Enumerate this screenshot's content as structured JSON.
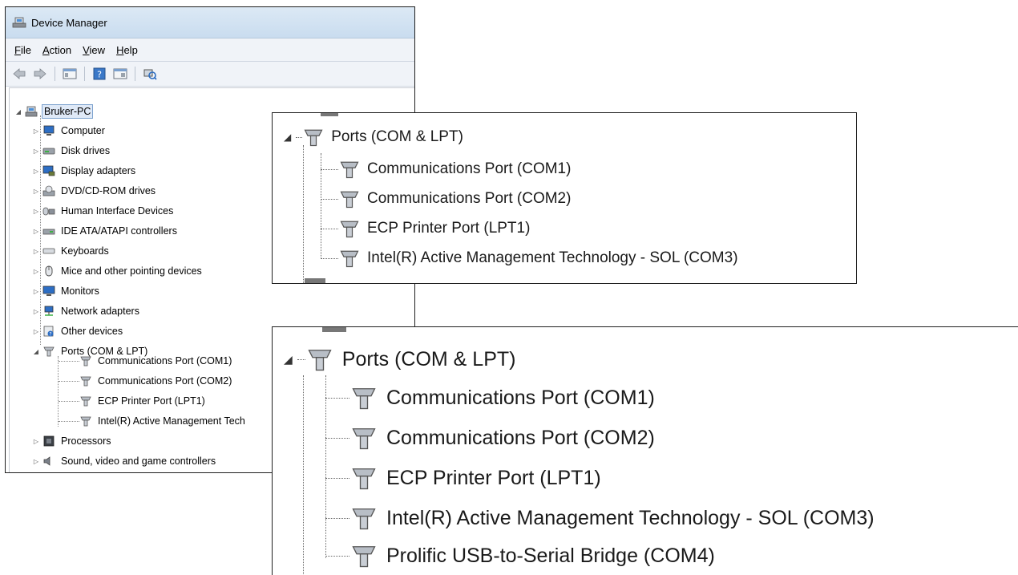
{
  "window": {
    "title": "Device Manager",
    "menu": [
      {
        "label": "File",
        "accel": "F",
        "rest": "ile"
      },
      {
        "label": "Action",
        "accel": "A",
        "rest": "ction"
      },
      {
        "label": "View",
        "accel": "V",
        "rest": "iew"
      },
      {
        "label": "Help",
        "accel": "H",
        "rest": "elp"
      }
    ],
    "toolbar": [
      "back-icon",
      "forward-icon",
      "properties-icon",
      "help-icon",
      "update-driver-icon",
      "scan-hardware-icon"
    ]
  },
  "tree": {
    "root": "Bruker-PC",
    "categories": [
      {
        "label": "Computer",
        "icon": "computer-icon"
      },
      {
        "label": "Disk drives",
        "icon": "disk-drive-icon"
      },
      {
        "label": "Display adapters",
        "icon": "display-adapter-icon"
      },
      {
        "label": "DVD/CD-ROM drives",
        "icon": "dvd-drive-icon"
      },
      {
        "label": "Human Interface Devices",
        "icon": "hid-icon"
      },
      {
        "label": "IDE ATA/ATAPI controllers",
        "icon": "ide-controller-icon"
      },
      {
        "label": "Keyboards",
        "icon": "keyboard-icon"
      },
      {
        "label": "Mice and other pointing devices",
        "icon": "mouse-icon"
      },
      {
        "label": "Monitors",
        "icon": "monitor-icon"
      },
      {
        "label": "Network adapters",
        "icon": "network-adapter-icon"
      },
      {
        "label": "Other devices",
        "icon": "other-devices-icon"
      },
      {
        "label": "Ports (COM & LPT)",
        "icon": "port-icon",
        "expanded": true
      },
      {
        "label": "Processors",
        "icon": "processor-icon"
      },
      {
        "label": "Sound, video and game controllers",
        "icon": "sound-icon"
      }
    ],
    "ports_children": [
      "Communications Port (COM1)",
      "Communications Port (COM2)",
      "ECP Printer Port (LPT1)",
      "Intel(R) Active Management Tech"
    ]
  },
  "zoom_before": {
    "category": "Ports (COM & LPT)",
    "items": [
      "Communications Port (COM1)",
      "Communications Port (COM2)",
      "ECP Printer Port (LPT1)",
      "Intel(R) Active Management Technology - SOL (COM3)"
    ]
  },
  "zoom_after": {
    "category": "Ports (COM & LPT)",
    "items": [
      "Communications Port (COM1)",
      "Communications Port (COM2)",
      "ECP Printer Port (LPT1)",
      "Intel(R) Active Management Technology - SOL (COM3)",
      "Prolific USB-to-Serial Bridge (COM4)"
    ]
  },
  "colors": {
    "selection_border": "#7da2ce",
    "selection_fill": "#dfe9f7",
    "titlebar": "#c9dcef"
  }
}
